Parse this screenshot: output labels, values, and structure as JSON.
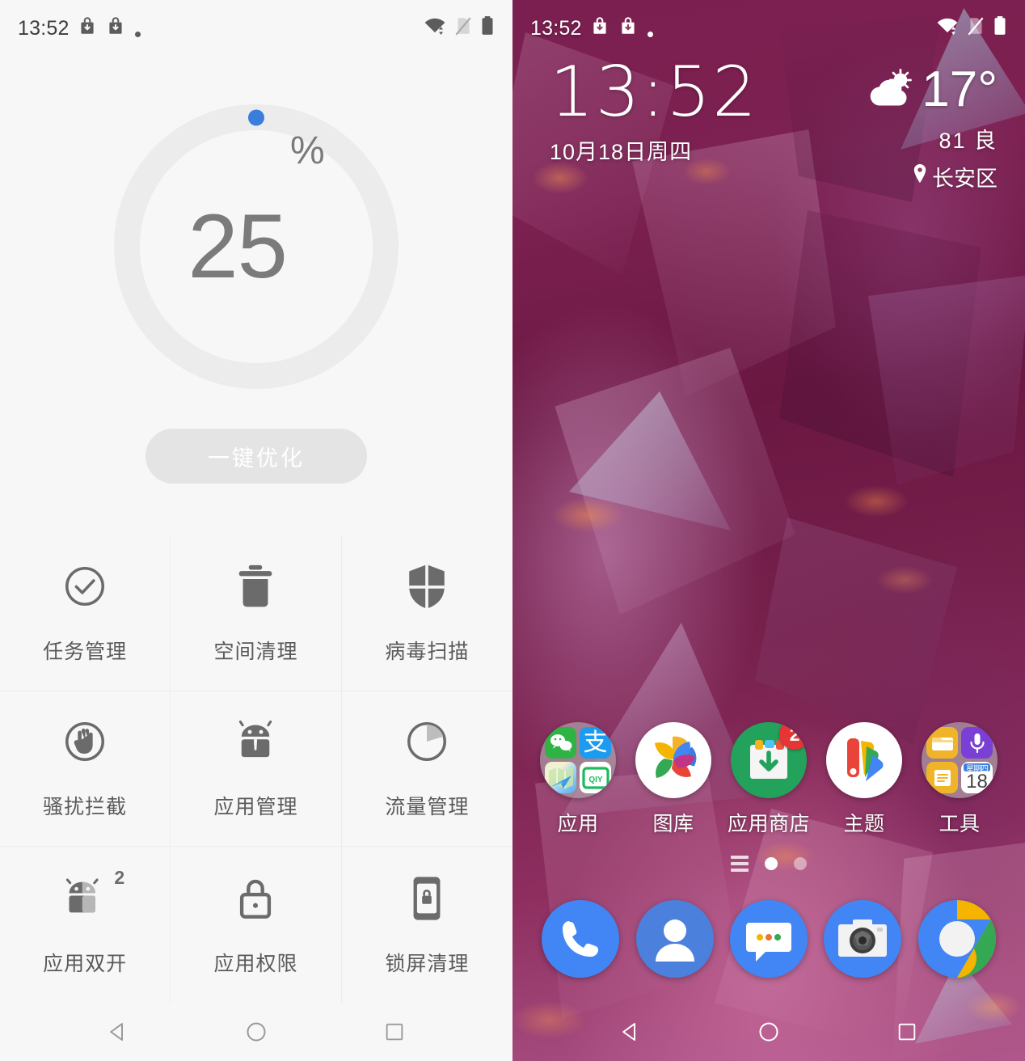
{
  "left_phone": {
    "status_bar": {
      "time": "13:52",
      "icons": [
        "download-bag-icon",
        "download-bag-icon",
        "small-dot-icon"
      ],
      "right_icons": [
        "wifi-transfer-icon",
        "sim-card-off-icon",
        "battery-icon"
      ]
    },
    "gauge": {
      "value": "25",
      "unit": "%",
      "progress_percent": 0,
      "ring_color": "#ececec",
      "marker_color": "#3b7ddd"
    },
    "optimize_button": {
      "label": "一键优化",
      "bg_color": "#e4e4e4",
      "text_color": "#ffffff"
    },
    "features": [
      {
        "label": "任务管理",
        "icon": "check-circle-icon",
        "badge": ""
      },
      {
        "label": "空间清理",
        "icon": "trash-icon",
        "badge": ""
      },
      {
        "label": "病毒扫描",
        "icon": "shield-icon",
        "badge": ""
      },
      {
        "label": "骚扰拦截",
        "icon": "hand-block-icon",
        "badge": ""
      },
      {
        "label": "应用管理",
        "icon": "android-robot-icon",
        "badge": ""
      },
      {
        "label": "流量管理",
        "icon": "data-pie-icon",
        "badge": ""
      },
      {
        "label": "应用双开",
        "icon": "android-clone-icon",
        "badge": "2"
      },
      {
        "label": "应用权限",
        "icon": "lock-icon",
        "badge": ""
      },
      {
        "label": "锁屏清理",
        "icon": "phone-lock-icon",
        "badge": ""
      }
    ],
    "nav_bar": [
      {
        "name": "back",
        "icon": "triangle-back-icon"
      },
      {
        "name": "home",
        "icon": "circle-home-icon"
      },
      {
        "name": "recents",
        "icon": "square-recents-icon"
      }
    ]
  },
  "right_phone": {
    "status_bar": {
      "time": "13:52",
      "icons": [
        "download-bag-icon",
        "download-bag-icon",
        "small-dot-icon"
      ],
      "right_icons": [
        "wifi-transfer-icon",
        "sim-card-off-icon",
        "battery-icon"
      ]
    },
    "clock_widget": {
      "time": "13:52",
      "date": "10月18日周四"
    },
    "weather_widget": {
      "icon": "partly-cloudy-icon",
      "temperature": "17°",
      "aqi": "81 良",
      "location": "长安区"
    },
    "apps": [
      {
        "label": "应用",
        "icon": "app-folder-icon",
        "badge": ""
      },
      {
        "label": "图库",
        "icon": "gallery-pinwheel-icon",
        "badge": ""
      },
      {
        "label": "应用商店",
        "icon": "app-store-bag-icon",
        "badge": "2"
      },
      {
        "label": "主题",
        "icon": "theme-fan-icon",
        "badge": ""
      },
      {
        "label": "工具",
        "icon": "tools-folder-icon",
        "badge": ""
      }
    ],
    "page_indicator": {
      "pages": 2,
      "active_index": 0
    },
    "dock": [
      {
        "name": "phone",
        "icon": "phone-icon"
      },
      {
        "name": "contacts",
        "icon": "contacts-icon"
      },
      {
        "name": "messages",
        "icon": "message-bubble-icon"
      },
      {
        "name": "camera",
        "icon": "camera-icon"
      },
      {
        "name": "browser",
        "icon": "browser-icon"
      }
    ],
    "nav_bar": [
      {
        "name": "back",
        "icon": "triangle-back-icon"
      },
      {
        "name": "home",
        "icon": "circle-home-icon"
      },
      {
        "name": "recents",
        "icon": "square-recents-icon"
      }
    ]
  }
}
